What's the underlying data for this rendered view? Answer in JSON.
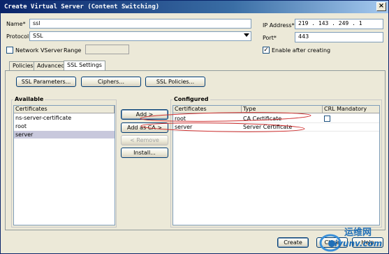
{
  "window": {
    "title": "Create Virtual Server (Content Switching)",
    "close_glyph": "×"
  },
  "form": {
    "name_label": "Name*",
    "name_value": "ssl",
    "protocol_label": "Protocol",
    "protocol_value": "SSL",
    "network_vserver_label": "Network VServer",
    "network_vserver_checked": false,
    "range_label": "Range",
    "range_value": "",
    "ip_label": "IP Address*",
    "ip_value": "219 . 143 . 249 . 1",
    "port_label": "Port*",
    "port_value": "443",
    "enable_label": "Enable after creating",
    "enable_checked": true
  },
  "tabs": [
    "Policies",
    "Advanced",
    "SSL Settings"
  ],
  "active_tab": "SSL Settings",
  "toolbar": {
    "ssl_parameters": "SSL Parameters...",
    "ciphers": "Ciphers...",
    "ssl_policies": "SSL Policies..."
  },
  "available": {
    "title": "Available",
    "header": "Certificates",
    "rows": [
      "ns-server-certificate",
      "root",
      "server"
    ],
    "selected_index": 2
  },
  "middle_buttons": {
    "add": "Add >",
    "add_as_ca": "Add as CA >",
    "remove": "< Remove",
    "install": "Install..."
  },
  "configured": {
    "title": "Configured",
    "headers": [
      "Certificates",
      "Type",
      "CRL Mandatory"
    ],
    "rows": [
      {
        "cert": "root",
        "type": "CA Certificate",
        "crl": "checkbox"
      },
      {
        "cert": "server",
        "type": "Server Certificate",
        "crl": ""
      }
    ]
  },
  "footer": {
    "create": "Create",
    "close": "Close",
    "help": "Help"
  },
  "watermark": {
    "text_cn": "运维网",
    "text_en": "iyunv.com",
    "color": "#1f6fb8"
  },
  "colors": {
    "titlebar": "#0a246a",
    "dialog_bg": "#ece9d8",
    "annotation": "#d03030"
  }
}
